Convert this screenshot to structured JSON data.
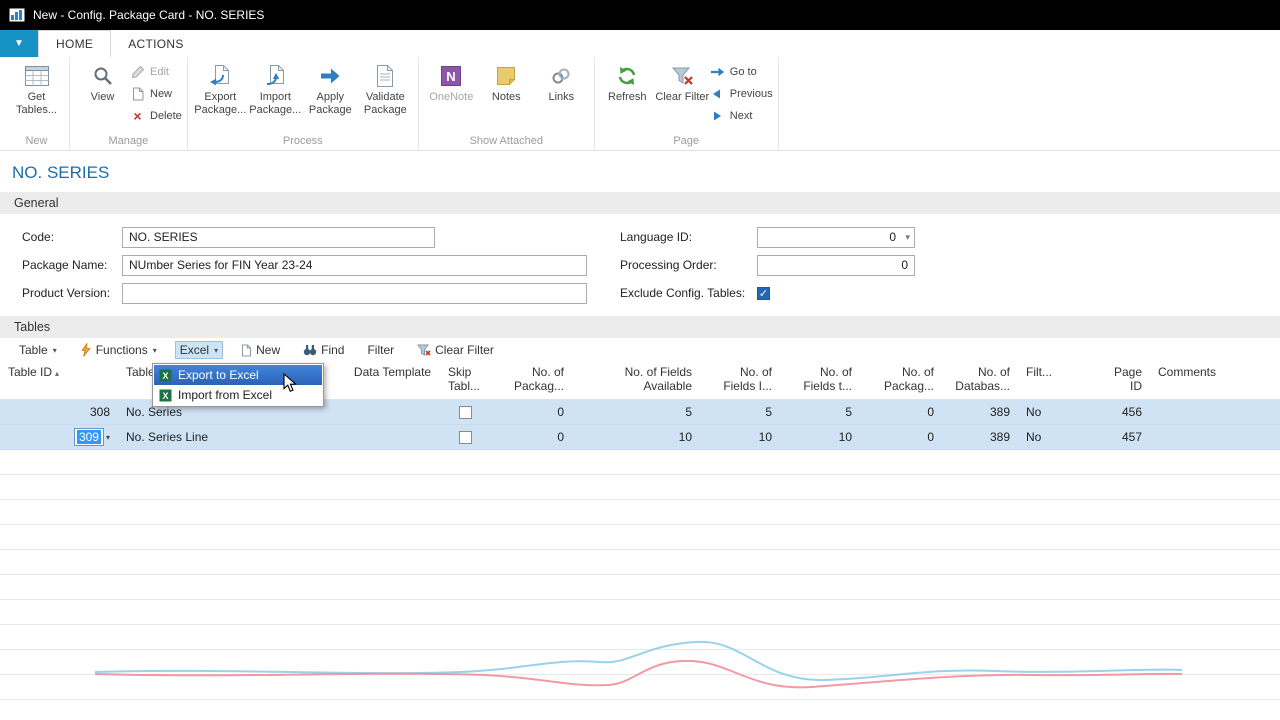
{
  "palette": {
    "titlebar_bg": "#000000",
    "accent_blue": "#1c6ea4",
    "tab_button_bg": "#1792c4",
    "selection_row": "#cfe3f5",
    "menu_highlight": "#2a62b8",
    "band_bg": "#ececec",
    "wave_blue": "#8fcdea",
    "wave_red": "#ef8f9b"
  },
  "titlebar": {
    "title": "New - Config. Package Card - NO. SERIES"
  },
  "tabs": {
    "home": "HOME",
    "actions": "ACTIONS"
  },
  "ribbon": {
    "groups": {
      "new": {
        "label": "New",
        "get_tables": "Get Tables..."
      },
      "manage": {
        "label": "Manage",
        "view": "View",
        "edit": "Edit",
        "new": "New",
        "delete": "Delete"
      },
      "process": {
        "label": "Process",
        "export": "Export Package...",
        "import": "Import Package...",
        "apply": "Apply Package",
        "validate": "Validate Package"
      },
      "show_attached": {
        "label": "Show Attached",
        "onenote": "OneNote",
        "notes": "Notes",
        "links": "Links"
      },
      "page": {
        "label": "Page",
        "refresh": "Refresh",
        "clear_filter": "Clear Filter",
        "goto": "Go to",
        "previous": "Previous",
        "next": "Next"
      }
    }
  },
  "page": {
    "title": "NO. SERIES"
  },
  "general": {
    "header": "General",
    "code_label": "Code:",
    "code_value": "NO. SERIES",
    "package_name_label": "Package Name:",
    "package_name_value": "NUmber Series for FIN Year 23-24",
    "product_version_label": "Product Version:",
    "product_version_value": "",
    "language_id_label": "Language ID:",
    "language_id_value": "0",
    "processing_order_label": "Processing Order:",
    "processing_order_value": "0",
    "exclude_label": "Exclude Config. Tables:",
    "exclude_checked": true
  },
  "tables": {
    "header": "Tables",
    "toolbar": {
      "table": "Table",
      "functions": "Functions",
      "excel": "Excel",
      "new": "New",
      "find": "Find",
      "filter": "Filter",
      "clear_filter": "Clear Filter"
    },
    "excel_menu": {
      "items": [
        "Export to Excel",
        "Import from Excel"
      ]
    },
    "grid": {
      "headers": [
        "Table ID",
        "Table",
        "Data Template",
        "Skip Tabl...",
        "No. of Packag...",
        "No. of Fields Available",
        "No. of Fields I...",
        "No. of Fields t...",
        "No. of Packag...",
        "No. of Databas...",
        "Filt...",
        "Page ID",
        "Comments"
      ],
      "rows": [
        {
          "table_id": "308",
          "name": "No. Series",
          "data_template": "",
          "skip": false,
          "packages": "0",
          "fields_available": "5",
          "fields_included": "5",
          "fields_to": "5",
          "package_records": "0",
          "database_records": "389",
          "filtered": "No",
          "page_id": "456",
          "comments": ""
        },
        {
          "table_id": "309",
          "name": "No. Series Line",
          "data_template": "",
          "skip": false,
          "packages": "0",
          "fields_available": "10",
          "fields_included": "10",
          "fields_to": "10",
          "package_records": "0",
          "database_records": "389",
          "filtered": "No",
          "page_id": "457",
          "comments": ""
        }
      ]
    }
  }
}
